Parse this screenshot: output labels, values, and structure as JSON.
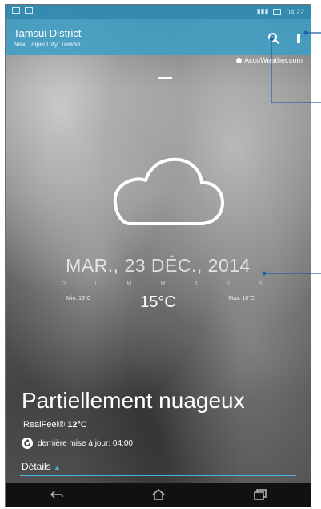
{
  "status": {
    "time": "04:22"
  },
  "app": {
    "city": "Tamsui District",
    "region": "New Taipei City, Taiwan",
    "provider": "AccuWeather.com"
  },
  "weather": {
    "date": "MAR., 23 DÉC., 2014",
    "days": [
      "D",
      "L",
      "M",
      "M",
      "J",
      "V",
      "S"
    ],
    "min": "Min. 13°C",
    "max": "Max. 16°C",
    "current_temp": "15°C",
    "condition": "Partiellement nuageux",
    "realfeel_label": "RealFeel®",
    "realfeel_value": "12°C",
    "updated": "dernière mise à jour: 04:00",
    "details_label": "Détails"
  },
  "colors": {
    "accent": "#46b3e0",
    "appbar": "#3ca0c8"
  },
  "icons": {
    "search": "search-icon",
    "more": "more-vert-icon",
    "cloud": "cloud-icon",
    "refresh": "refresh-icon",
    "back": "back-icon",
    "home": "home-icon",
    "recents": "recents-icon"
  }
}
